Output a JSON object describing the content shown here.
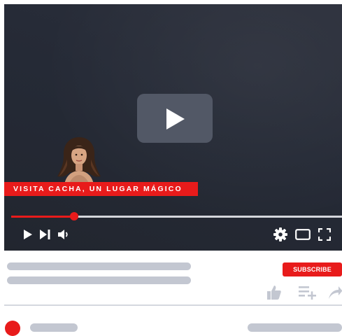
{
  "video": {
    "title_banner": "VISITA CACHA, UN LUGAR MÁGICO",
    "progress_fraction": 0.19,
    "player_bg": "#252a36",
    "accent": "#e81b1b"
  },
  "controls": {
    "play_icon": "play-icon",
    "next_icon": "skip-next-icon",
    "volume_icon": "volume-icon",
    "settings_icon": "gear-icon",
    "theater_icon": "theater-mode-icon",
    "fullscreen_icon": "fullscreen-icon"
  },
  "below": {
    "subscribe_label": "SUBSCRIBE",
    "actions": [
      "thumbs-up-icon",
      "add-to-playlist-icon",
      "share-icon"
    ],
    "placeholder_color": "#c3c7d1"
  }
}
